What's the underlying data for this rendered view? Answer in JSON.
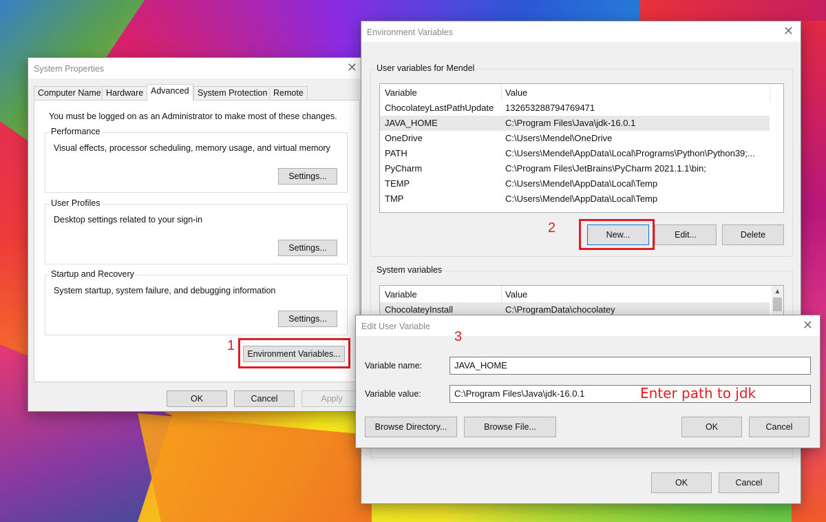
{
  "system_properties": {
    "title": "System Properties",
    "tabs": [
      "Computer Name",
      "Hardware",
      "Advanced",
      "System Protection",
      "Remote"
    ],
    "active_tab": "Advanced",
    "admin_note": "You must be logged on as an Administrator to make most of these changes.",
    "performance": {
      "label": "Performance",
      "description": "Visual effects, processor scheduling, memory usage, and virtual memory",
      "button": "Settings..."
    },
    "user_profiles": {
      "label": "User Profiles",
      "description": "Desktop settings related to your sign-in",
      "button": "Settings..."
    },
    "startup_recovery": {
      "label": "Startup and Recovery",
      "description": "System startup, system failure, and debugging information",
      "button": "Settings..."
    },
    "env_vars_button": "Environment Variables...",
    "ok": "OK",
    "cancel": "Cancel",
    "apply": "Apply"
  },
  "environment_variables": {
    "title": "Environment Variables",
    "user_group_label": "User variables for Mendel",
    "columns": {
      "variable": "Variable",
      "value": "Value"
    },
    "user_vars": [
      {
        "name": "ChocolateyLastPathUpdate",
        "value": "132653288794769471"
      },
      {
        "name": "JAVA_HOME",
        "value": "C:\\Program Files\\Java\\jdk-16.0.1"
      },
      {
        "name": "OneDrive",
        "value": "C:\\Users\\Mendel\\OneDrive"
      },
      {
        "name": "PATH",
        "value": "C:\\Users\\Mendel\\AppData\\Local\\Programs\\Python\\Python39;..."
      },
      {
        "name": "PyCharm",
        "value": "C:\\Program Files\\JetBrains\\PyCharm 2021.1.1\\bin;"
      },
      {
        "name": "TEMP",
        "value": "C:\\Users\\Mendel\\AppData\\Local\\Temp"
      },
      {
        "name": "TMP",
        "value": "C:\\Users\\Mendel\\AppData\\Local\\Temp"
      }
    ],
    "user_buttons": {
      "new": "New...",
      "edit": "Edit...",
      "delete": "Delete"
    },
    "system_group_label": "System variables",
    "system_vars": [
      {
        "name": "ChocolateyInstall",
        "value": "C:\\ProgramData\\chocolatey"
      }
    ],
    "ok": "OK",
    "cancel": "Cancel"
  },
  "edit_user_variable": {
    "title": "Edit User Variable",
    "name_label": "Variable name:",
    "name_value": "JAVA_HOME",
    "value_label": "Variable value:",
    "value_value": "C:\\Program Files\\Java\\jdk-16.0.1",
    "browse_directory": "Browse Directory...",
    "browse_file": "Browse File...",
    "ok": "OK",
    "cancel": "Cancel"
  },
  "annotations": {
    "step1": "1",
    "step2": "2",
    "step3": "3",
    "note": "Enter path to jdk",
    "color": "#e31b23"
  },
  "icons": {
    "close": "close-icon",
    "scroll_up": "chevron-up-icon"
  }
}
